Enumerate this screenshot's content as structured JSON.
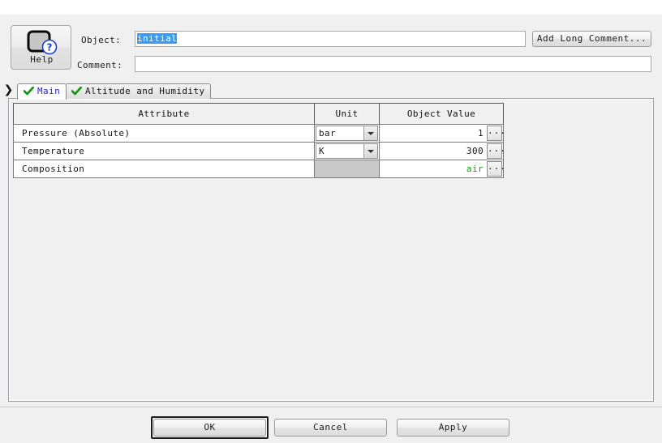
{
  "header": {
    "help_button": {
      "label": "Help",
      "icon": "help-question-icon"
    },
    "object": {
      "label": "Object:",
      "value": "initial",
      "selected": true
    },
    "comment": {
      "label": "Comment:",
      "value": "",
      "placeholder": ""
    },
    "add_long_comment": {
      "label": "Add Long Comment..."
    }
  },
  "tabs": {
    "scroll_arrow": "❯",
    "items": [
      {
        "label": "Main",
        "active": true,
        "check": "✔"
      },
      {
        "label": "Altitude and Humidity",
        "active": false,
        "check": "✔"
      }
    ]
  },
  "table": {
    "columns": [
      "Attribute",
      "Unit",
      "Object Value"
    ],
    "rows": [
      {
        "attribute": "Pressure (Absolute)",
        "unit": "bar",
        "unit_enabled": true,
        "value": "1",
        "value_color": "#141414",
        "ellipsis": "..."
      },
      {
        "attribute": "Temperature",
        "unit": "K",
        "unit_enabled": true,
        "value": "300",
        "value_color": "#141414",
        "ellipsis": "..."
      },
      {
        "attribute": "Composition",
        "unit": "",
        "unit_enabled": false,
        "value": "air",
        "value_color": "#0aa60a",
        "ellipsis": "..."
      }
    ]
  },
  "footer": {
    "ok": "OK",
    "cancel": "Cancel",
    "apply": "Apply",
    "default_button": "OK"
  },
  "colors": {
    "dialog_bg": "#f0f0f0",
    "selection_blue": "#3b9bf0",
    "active_tab_text": "#2222cc",
    "check_green": "#22aa22",
    "value_green": "#0aa60a"
  }
}
